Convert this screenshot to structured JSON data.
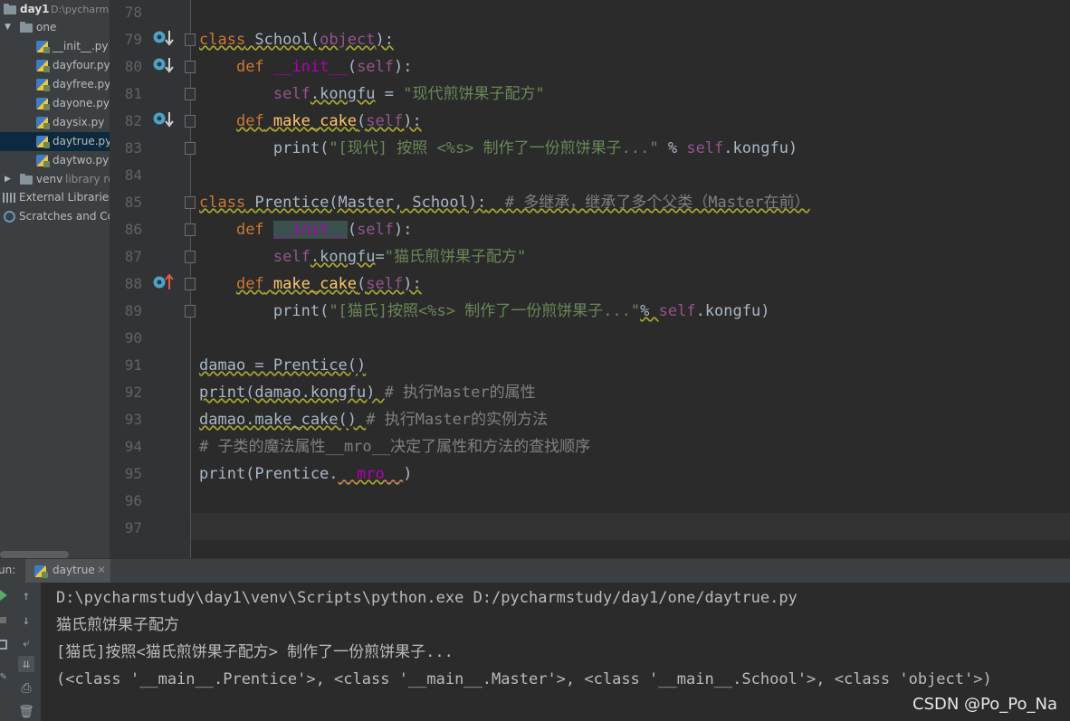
{
  "project": {
    "root_name": "day1",
    "root_path": "D:\\pycharm",
    "folder_one": "one",
    "files": [
      "__init__.py",
      "dayfour.py",
      "dayfree.py",
      "dayone.py",
      "daysix.py",
      "daytrue.py",
      "daytwo.py"
    ],
    "selected_file": "daytrue.py",
    "venv": "venv",
    "venv_hint": "library ro",
    "external_libraries": "External Libraries",
    "scratches": "Scratches and Co"
  },
  "editor": {
    "line_numbers": [
      "78",
      "79",
      "80",
      "81",
      "82",
      "83",
      "84",
      "85",
      "86",
      "87",
      "88",
      "89",
      "90",
      "91",
      "92",
      "93",
      "94",
      "95",
      "96",
      "97"
    ],
    "code": {
      "l79_kw": "class",
      "l79_name": " School(",
      "l79_base": "object",
      "l79_end": "):",
      "l80_kw": "def",
      "l80_name": "__init__",
      "l80_p1": "(",
      "l80_self": "self",
      "l80_p2": "):",
      "l81_self": "self",
      "l81_attr": ".kongfu",
      "l81_eq": " = ",
      "l81_str": "\"现代煎饼果子配方\"",
      "l82_kw": "def",
      "l82_name": "make_cake",
      "l82_p1": "(",
      "l82_self": "self",
      "l82_p2": "):",
      "l83_print": "print(",
      "l83_str": "\"[现代] 按照 <%s> 制作了一份煎饼果子...\"",
      "l83_op": " % ",
      "l83_self": "self",
      "l83_end": ".kongfu)",
      "l85_kw": "class",
      "l85_name": " Prentice(Master, School):",
      "l85_cm": "  # 多继承，继承了多个父类（Master在前）",
      "l86_kw": "def",
      "l86_name": "__init__",
      "l86_p1": "(",
      "l86_self": "self",
      "l86_p2": "):",
      "l87_self": "self",
      "l87_attr": ".kongfu",
      "l87_eq": "=",
      "l87_str": "\"猫氏煎饼果子配方\"",
      "l88_kw": "def",
      "l88_name": "make_cake",
      "l88_p1": "(",
      "l88_self": "self",
      "l88_p2": "):",
      "l89_print": "print(",
      "l89_str": "\"[猫氏]按照<%s> 制作了一份煎饼果子...\"",
      "l89_op": "% ",
      "l89_self": "self",
      "l89_end": ".kongfu)",
      "l91": "damao = Prentice()",
      "l92_code": "print(damao.kongfu) ",
      "l92_cm": "# 执行Master的属性",
      "l93_code": "damao.make_cake() ",
      "l93_cm": "# 执行Master的实例方法",
      "l94_cm": "# 子类的魔法属性__mro__决定了属性和方法的查找顺序",
      "l95_a": "print(Prentice.",
      "l95_magic": "__mro__",
      "l95_b": ")"
    }
  },
  "run": {
    "label": "un:",
    "tab_title": "daytrue",
    "output": [
      "D:\\pycharmstudy\\day1\\venv\\Scripts\\python.exe D:/pycharmstudy/day1/one/daytrue.py",
      "猫氏煎饼果子配方",
      "[猫氏]按照<猫氏煎饼果子配方> 制作了一份煎饼果子...",
      "(<class '__main__.Prentice'>, <class '__main__.Master'>, <class '__main__.School'>, <class 'object'>)"
    ]
  },
  "watermark": "CSDN @Po_Po_Na",
  "colors": {
    "keyword": "#cc7832",
    "string": "#6a8759",
    "self": "#94558d",
    "function": "#ffc66d",
    "comment": "#808080"
  }
}
